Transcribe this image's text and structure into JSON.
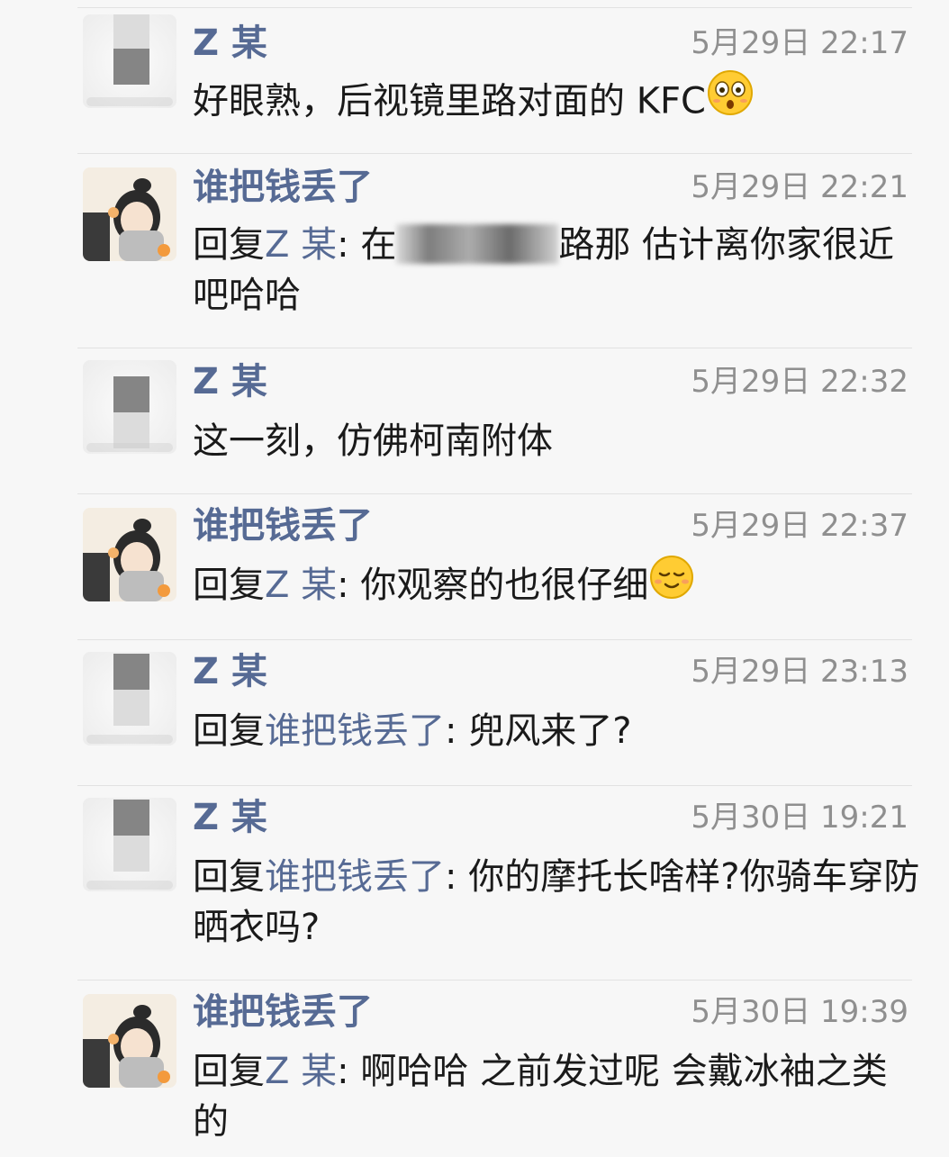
{
  "comments": [
    {
      "author": "Z 某",
      "time": "5月29日 22:17",
      "text": "好眼熟，后视镜里路对面的 KFC",
      "emoji": "flushed-face-icon"
    },
    {
      "author": "谁把钱丢了",
      "time": "5月29日 22:21",
      "reply_prefix": "回复",
      "reply_to": "Z 某",
      "reply_sep": ": ",
      "text_before": "在",
      "text_after": "路那 估计离你家很近吧哈哈"
    },
    {
      "author": "Z 某",
      "time": "5月29日 22:32",
      "text": "这一刻，仿佛柯南附体"
    },
    {
      "author": "谁把钱丢了",
      "time": "5月29日 22:37",
      "reply_prefix": "回复",
      "reply_to": "Z 某",
      "reply_sep": ": ",
      "text": "你观察的也很仔细",
      "emoji": "relieved-face-icon"
    },
    {
      "author": "Z 某",
      "time": "5月29日 23:13",
      "reply_prefix": "回复",
      "reply_to": "谁把钱丢了",
      "reply_sep": ": ",
      "text": "兜风来了?"
    },
    {
      "author": "Z 某",
      "time": "5月30日 19:21",
      "reply_prefix": "回复",
      "reply_to": "谁把钱丢了",
      "reply_sep": ": ",
      "text": "你的摩托长啥样?你骑车穿防晒衣吗?"
    },
    {
      "author": "谁把钱丢了",
      "time": "5月30日 19:39",
      "reply_prefix": "回复",
      "reply_to": "Z 某",
      "reply_sep": ": ",
      "text": "啊哈哈 之前发过呢 会戴冰袖之类的"
    }
  ],
  "colors": {
    "name": "#566a94",
    "time": "#8f8f8f",
    "text": "#1a1a1a",
    "background": "#f7f7f7",
    "divider": "#e2e2e2"
  }
}
